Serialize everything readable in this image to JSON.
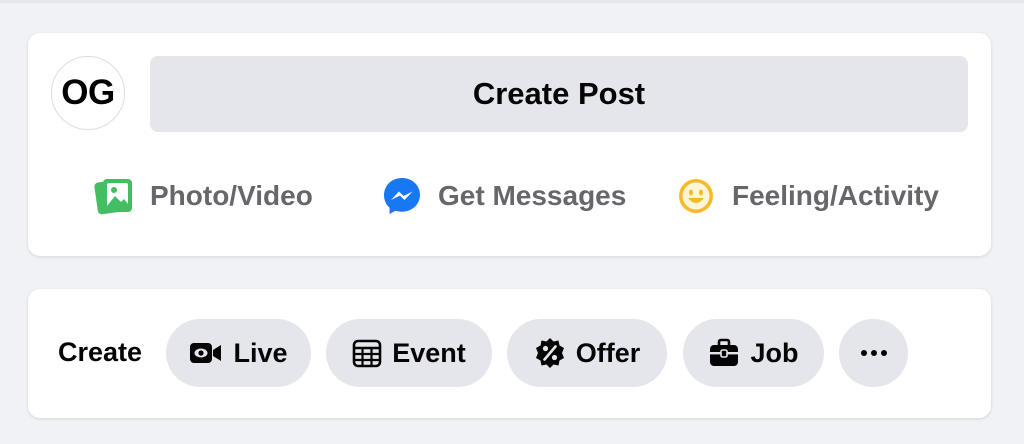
{
  "composer": {
    "avatar_initials": "OG",
    "create_post_label": "Create Post",
    "actions": [
      {
        "label": "Photo/Video",
        "icon": "photo-video-icon",
        "color": "#45bd62"
      },
      {
        "label": "Get Messages",
        "icon": "messenger-icon",
        "color": "#1877f2"
      },
      {
        "label": "Feeling/Activity",
        "icon": "feeling-icon",
        "color": "#f7b928"
      }
    ]
  },
  "create_bar": {
    "label": "Create",
    "chips": [
      {
        "label": "Live",
        "icon": "live-video-icon"
      },
      {
        "label": "Event",
        "icon": "calendar-icon"
      },
      {
        "label": "Offer",
        "icon": "offer-badge-icon"
      },
      {
        "label": "Job",
        "icon": "briefcase-icon"
      },
      {
        "label": "",
        "icon": "more-icon"
      }
    ]
  },
  "colors": {
    "page_background": "#f0f2f5",
    "card_background": "#ffffff",
    "button_background": "#e4e6eb",
    "secondary_text": "#65676b",
    "primary_text": "#050505"
  }
}
